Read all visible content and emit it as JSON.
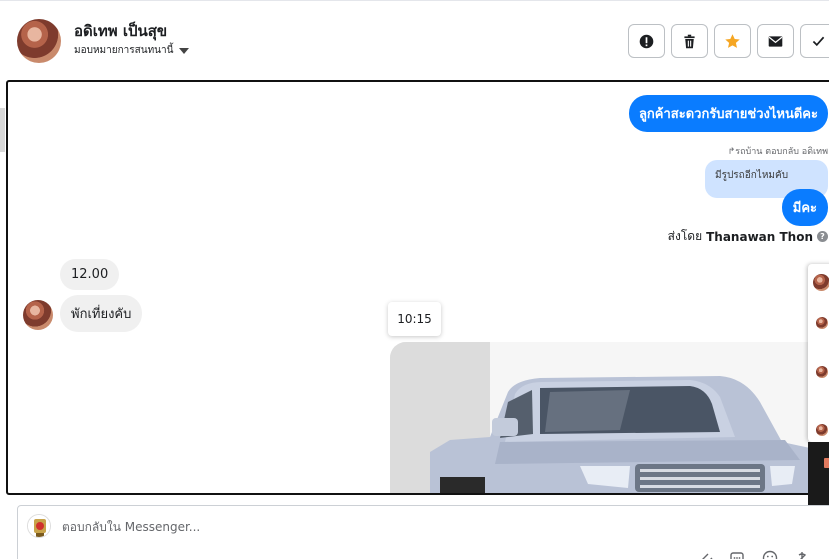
{
  "header": {
    "contact_name": "อดิเทพ เป็นสุข",
    "assign_label": "มอบหมายการสนทนานี้"
  },
  "toolbar": {
    "buttons": [
      {
        "name": "mark-spam",
        "icon": "alert-circle-icon"
      },
      {
        "name": "delete",
        "icon": "trash-icon"
      },
      {
        "name": "star",
        "icon": "star-icon",
        "color": "#f5a623"
      },
      {
        "name": "mark-unread",
        "icon": "envelope-icon"
      },
      {
        "name": "done",
        "icon": "check-icon"
      }
    ]
  },
  "messages": {
    "outgoing_1": "ลูกค้าสะดวกรับสายช่วงไหนดีคะ",
    "reply_note": "↱รถบ้าน ตอบกลับ อดิเทพ",
    "reply_quote": "มีรูปรถอีกไหมคับ",
    "outgoing_2": "มีคะ",
    "sent_by_prefix": "ส่งโดย",
    "sent_by_name": "Thanawan Thon",
    "incoming_1": "12.00",
    "incoming_2": "พักเที่ยงคับ",
    "time_tooltip": "10:15"
  },
  "composer": {
    "placeholder": "ตอบกลับใน Messenger..."
  },
  "colors": {
    "outgoing_bubble": "#0a7cff",
    "incoming_bubble": "#f0f0f0",
    "reply_quote_bg": "#cfe3ff"
  }
}
